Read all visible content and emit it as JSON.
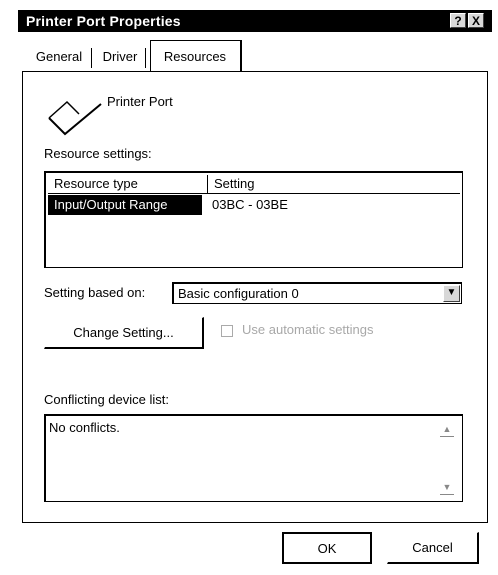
{
  "window": {
    "title": "Printer Port Properties",
    "help_button": "?",
    "close_button": "X"
  },
  "tabs": [
    {
      "label": "General",
      "selected": false
    },
    {
      "label": "Driver",
      "selected": false
    },
    {
      "label": "Resources",
      "selected": true
    }
  ],
  "device": {
    "icon": "printer-port-icon",
    "name": "Printer Port"
  },
  "resource_settings": {
    "label": "Resource settings:",
    "columns": [
      "Resource type",
      "Setting"
    ],
    "rows": [
      {
        "type": "Input/Output Range",
        "setting": "03BC - 03BE",
        "selected": true
      }
    ]
  },
  "setting_based_on": {
    "label": "Setting based on:",
    "value": "Basic configuration 0"
  },
  "change_setting_button": "Change Setting...",
  "use_automatic": {
    "label": "Use automatic settings",
    "checked": false,
    "enabled": false
  },
  "conflicts": {
    "label": "Conflicting device list:",
    "text": "No conflicts."
  },
  "footer": {
    "ok_label": "OK",
    "cancel_label": "Cancel"
  },
  "colors": {
    "title_bar": "#000000",
    "selection": "#000000",
    "disabled_text": "#a8a8a8"
  }
}
